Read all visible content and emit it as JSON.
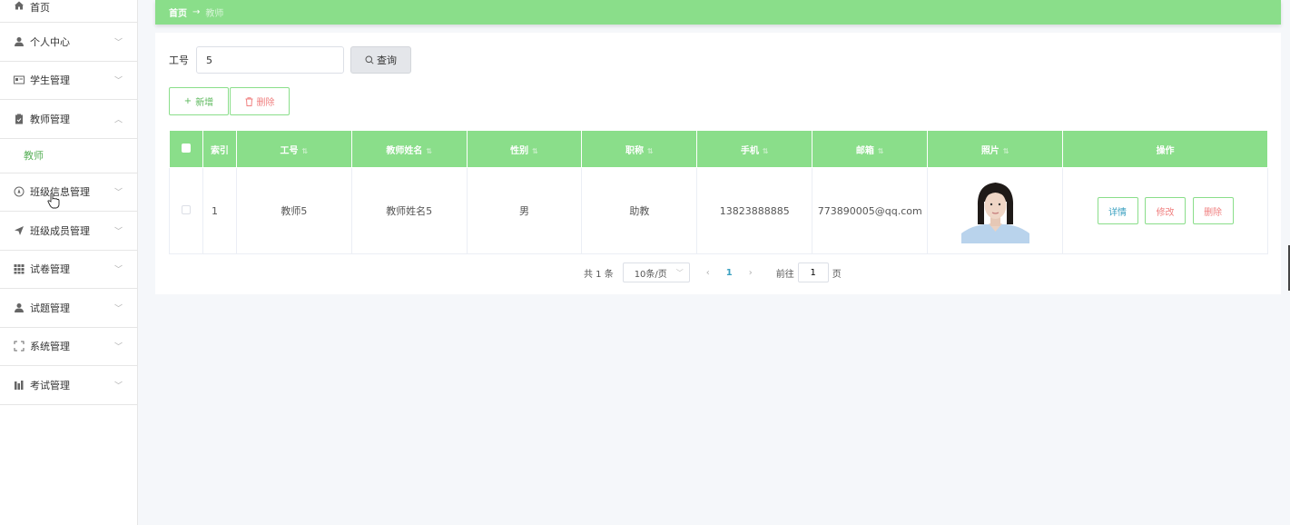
{
  "sidebar": {
    "items": [
      {
        "label": "首页",
        "icon": "home-icon"
      },
      {
        "label": "个人中心",
        "icon": "user-icon"
      },
      {
        "label": "学生管理",
        "icon": "id-card-icon"
      },
      {
        "label": "教师管理",
        "icon": "clipboard-icon"
      },
      {
        "label": "班级信息管理",
        "icon": "compass-icon"
      },
      {
        "label": "班级成员管理",
        "icon": "send-icon"
      },
      {
        "label": "试卷管理",
        "icon": "grid-icon"
      },
      {
        "label": "试题管理",
        "icon": "user-icon"
      },
      {
        "label": "系统管理",
        "icon": "fullscreen-icon"
      },
      {
        "label": "考试管理",
        "icon": "chart-icon"
      }
    ],
    "submenu_teacher": "教师"
  },
  "breadcrumb": {
    "home": "首页",
    "arrow": "→",
    "current": "教师"
  },
  "search": {
    "label": "工号",
    "value": "5",
    "button": "查询"
  },
  "actions": {
    "add": "新增",
    "delete": "删除"
  },
  "table": {
    "headers": [
      "索引",
      "工号",
      "教师姓名",
      "性别",
      "职称",
      "手机",
      "邮箱",
      "照片",
      "操作"
    ],
    "rows": [
      {
        "index": "1",
        "id": "教师5",
        "name": "教师姓名5",
        "gender": "男",
        "title": "助教",
        "phone": "13823888885",
        "email": "773890005@qq.com"
      }
    ],
    "row_actions": {
      "detail": "详情",
      "edit": "修改",
      "delete": "删除"
    }
  },
  "pagination": {
    "total": "共 1 条",
    "page_size": "10条/页",
    "current_page": "1",
    "goto_label": "前往",
    "goto_value": "1",
    "page_unit": "页"
  },
  "colors": {
    "accent": "#8ade8a",
    "link": "#3aa0c0",
    "danger": "#f08080"
  }
}
